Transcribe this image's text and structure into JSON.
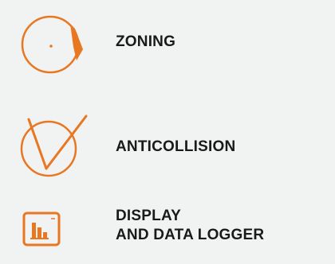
{
  "colors": {
    "accent": "#e87722",
    "text": "#1a1a1a",
    "background": "#f1f2f2"
  },
  "features": [
    {
      "icon": "zoning-radar-icon",
      "label": "ZONING"
    },
    {
      "icon": "anticollision-icon",
      "label": "ANTICOLLISION"
    },
    {
      "icon": "display-data-logger-icon",
      "label_lines": [
        "DISPLAY",
        "AND DATA LOGGER"
      ]
    }
  ]
}
